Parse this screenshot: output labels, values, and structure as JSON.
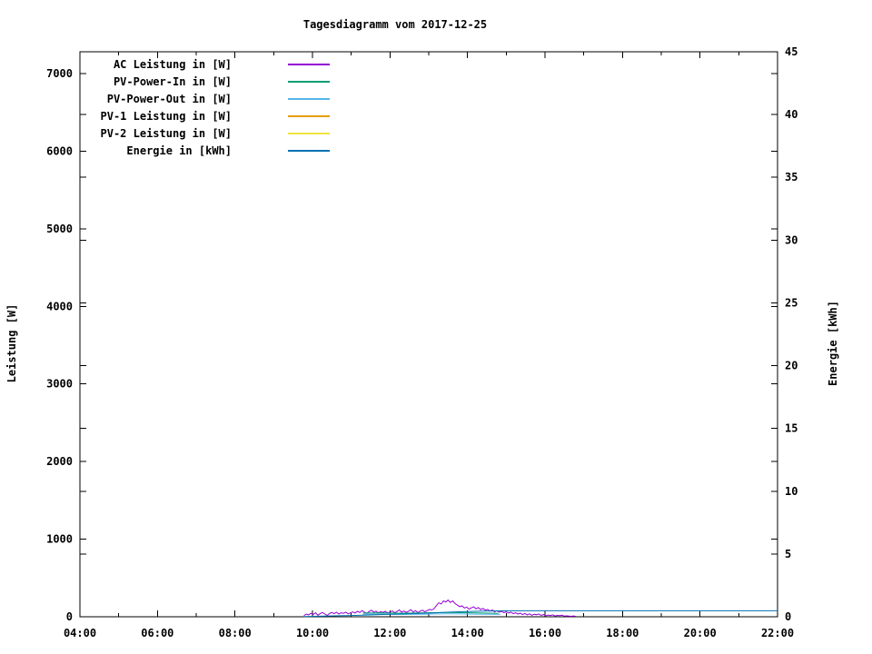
{
  "chart_data": {
    "type": "line",
    "title": "Tagesdiagramm vom 2017-12-25",
    "grid": false,
    "legend_position": "top-left-inside",
    "x_axis": {
      "label": "",
      "range_hours": [
        4,
        22
      ],
      "major_tick_hours": [
        4,
        6,
        8,
        10,
        12,
        14,
        16,
        18,
        20,
        22
      ],
      "major_tick_labels": [
        "04:00",
        "06:00",
        "08:00",
        "10:00",
        "12:00",
        "14:00",
        "16:00",
        "18:00",
        "20:00",
        "22:00"
      ],
      "minor_tick_hours": [
        5,
        7,
        9,
        11,
        13,
        15,
        17,
        19,
        21
      ]
    },
    "y_axis_left": {
      "label": "Leistung [W]",
      "range": [
        0,
        7280
      ],
      "major_ticks": [
        0,
        1000,
        2000,
        3000,
        4000,
        5000,
        6000,
        7000
      ],
      "major_tick_labels": [
        "0",
        "1000",
        "2000",
        "3000",
        "4000",
        "5000",
        "6000",
        "7000"
      ]
    },
    "y_axis_right": {
      "label": "Energie [kWh]",
      "range": [
        0,
        45
      ],
      "major_ticks": [
        0,
        5,
        10,
        15,
        20,
        25,
        30,
        35,
        40,
        45
      ],
      "major_tick_labels": [
        "0",
        "5",
        "10",
        "15",
        "20",
        "25",
        "30",
        "35",
        "40",
        "45"
      ]
    },
    "series": [
      {
        "name": "AC Leistung in [W]",
        "color": "#9400D3",
        "axis": "left",
        "points_compact": {
          "t0": 9.78,
          "dt": 0.06,
          "values": [
            15,
            35,
            25,
            45,
            30,
            50,
            20,
            40,
            55,
            35,
            18,
            42,
            55,
            40,
            58,
            35,
            52,
            44,
            60,
            38,
            50,
            62,
            48,
            70,
            55,
            80,
            58,
            45,
            65,
            85,
            60,
            72,
            50,
            66,
            56,
            70,
            48,
            60,
            75,
            52,
            68,
            88,
            58,
            74,
            56,
            70,
            90,
            62,
            78,
            55,
            72,
            84,
            64,
            78,
            95,
            88,
            105,
            145,
            180,
            165,
            205,
            190,
            215,
            185,
            205,
            170,
            150,
            130,
            140,
            112,
            125,
            98,
            115,
            128,
            102,
            118,
            92,
            108,
            85,
            95,
            72,
            88,
            62,
            78,
            58,
            70,
            52,
            64,
            48,
            58,
            40,
            52,
            34,
            46,
            28,
            42,
            25,
            38,
            20,
            32,
            26,
            36,
            18,
            28,
            12,
            22,
            16,
            24,
            10,
            18,
            14,
            20,
            8,
            12,
            8,
            6,
            10,
            5
          ]
        }
      },
      {
        "name": "PV-Power-In in [W]",
        "color": "#009E73",
        "axis": "left",
        "points": [
          [
            11.3,
            48
          ],
          [
            11.8,
            50
          ],
          [
            12.3,
            46
          ],
          [
            12.8,
            50
          ],
          [
            13.2,
            54
          ],
          [
            13.6,
            55
          ],
          [
            14.0,
            52
          ],
          [
            14.4,
            48
          ],
          [
            14.8,
            45
          ]
        ]
      },
      {
        "name": "PV-Power-Out in [W]",
        "color": "#56B4E9",
        "axis": "left",
        "points": [
          [
            11.3,
            32
          ],
          [
            11.8,
            34
          ],
          [
            12.3,
            30
          ],
          [
            12.8,
            33
          ],
          [
            13.2,
            36
          ],
          [
            13.6,
            37
          ],
          [
            14.0,
            35
          ],
          [
            14.4,
            33
          ],
          [
            14.85,
            30
          ]
        ]
      },
      {
        "name": "PV-1 Leistung in [W]",
        "color": "#E69F00",
        "axis": "left",
        "points": []
      },
      {
        "name": "PV-2 Leistung in [W]",
        "color": "#F0E442",
        "axis": "left",
        "points": []
      },
      {
        "name": "Energie in [kWh]",
        "color": "#0072B2",
        "axis": "right",
        "points": [
          [
            9.78,
            0.02
          ],
          [
            10.3,
            0.05
          ],
          [
            10.8,
            0.09
          ],
          [
            11.3,
            0.13
          ],
          [
            11.8,
            0.18
          ],
          [
            12.3,
            0.22
          ],
          [
            12.8,
            0.27
          ],
          [
            13.2,
            0.32
          ],
          [
            13.6,
            0.38
          ],
          [
            14.0,
            0.42
          ],
          [
            14.4,
            0.45
          ],
          [
            14.9,
            0.47
          ],
          [
            15.5,
            0.48
          ],
          [
            16.5,
            0.48
          ],
          [
            22.0,
            0.48
          ]
        ]
      }
    ]
  }
}
